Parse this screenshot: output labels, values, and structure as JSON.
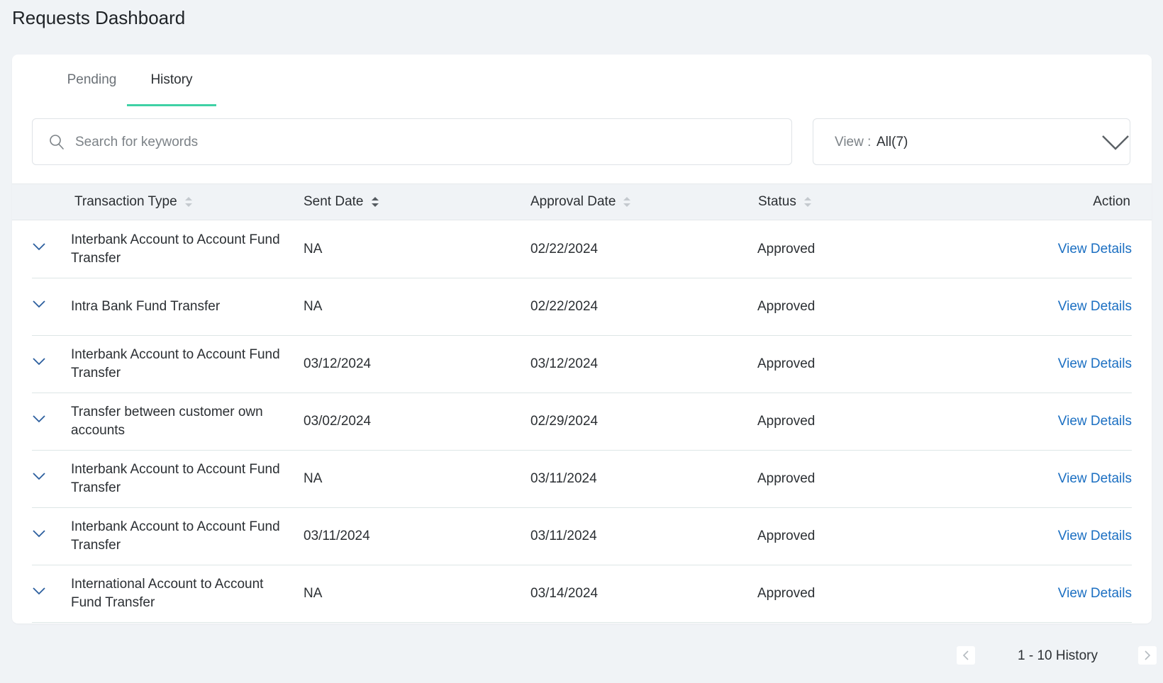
{
  "page": {
    "title": "Requests Dashboard"
  },
  "tabs": [
    {
      "label": "Pending",
      "active": false
    },
    {
      "label": "History",
      "active": true
    }
  ],
  "search": {
    "placeholder": "Search for keywords",
    "value": ""
  },
  "view_filter": {
    "label": "View :",
    "value": "All(7)"
  },
  "table": {
    "columns": {
      "transaction_type": "Transaction Type",
      "sent_date": "Sent Date",
      "approval_date": "Approval Date",
      "status": "Status",
      "action": "Action"
    },
    "rows": [
      {
        "type_line1": "Interbank Account to Account Fund",
        "type_line2": "Transfer",
        "sent": "NA",
        "approval": "02/22/2024",
        "status": "Approved",
        "action": "View Details"
      },
      {
        "type_line1": "Intra Bank Fund Transfer",
        "type_line2": "",
        "sent": "NA",
        "approval": "02/22/2024",
        "status": "Approved",
        "action": "View Details"
      },
      {
        "type_line1": "Interbank Account to Account Fund",
        "type_line2": "Transfer",
        "sent": "03/12/2024",
        "approval": "03/12/2024",
        "status": "Approved",
        "action": "View Details"
      },
      {
        "type_line1": "Transfer between customer own",
        "type_line2": "accounts",
        "sent": "03/02/2024",
        "approval": "02/29/2024",
        "status": "Approved",
        "action": "View Details"
      },
      {
        "type_line1": "Interbank Account to Account Fund",
        "type_line2": "Transfer",
        "sent": "NA",
        "approval": "03/11/2024",
        "status": "Approved",
        "action": "View Details"
      },
      {
        "type_line1": "Interbank Account to Account Fund",
        "type_line2": "Transfer",
        "sent": "03/11/2024",
        "approval": "03/11/2024",
        "status": "Approved",
        "action": "View Details"
      },
      {
        "type_line1": "International Account to Account",
        "type_line2": "Fund Transfer",
        "sent": "NA",
        "approval": "03/14/2024",
        "status": "Approved",
        "action": "View Details"
      }
    ]
  },
  "pagination": {
    "text": "1 - 10 History"
  },
  "icons": {
    "search": "search-icon",
    "dropdown": "chevron-down-icon",
    "sort": "sort-icon",
    "expand": "chevron-down-icon",
    "prev": "chevron-left-icon",
    "next": "chevron-right-icon"
  },
  "colors": {
    "accent": "#3fd1a5",
    "link": "#1b6fc2",
    "background": "#f0f3f6"
  }
}
